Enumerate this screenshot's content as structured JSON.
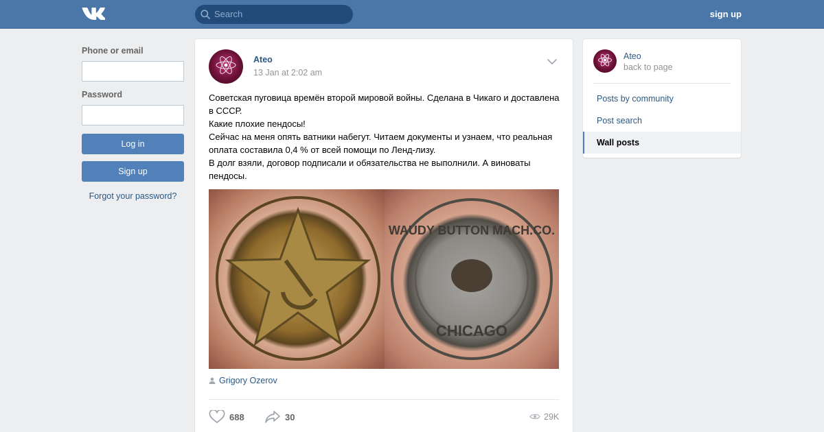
{
  "header": {
    "logo_icon": "vk-logo-icon",
    "search_placeholder": "Search",
    "signup_label": "sign up"
  },
  "login": {
    "email_label": "Phone or email",
    "email_value": "",
    "password_label": "Password",
    "password_value": "",
    "login_button": "Log in",
    "signup_button": "Sign up",
    "forgot_link": "Forgot your password?"
  },
  "post": {
    "author": "Ateo",
    "date": "13 Jan at 2:02 am",
    "text_lines": [
      "Советская пуговица времён второй мировой войны. Сделана в Чикаго и доставлена в СССР.",
      "Какие плохие пендосы!",
      "Сейчас на меня опять ватники набегут. Читаем документы и узнаем, что реальная оплата составила 0,4 % от всей помощи по Ленд-лизу.",
      "В долг взяли, договор подписали и обязательства не выполнили. А виноваты пендосы."
    ],
    "photo1_icon": "soviet-button-front-photo",
    "photo2_icon": "chicago-button-back-photo",
    "photo2_text": {
      "maker": "WAUDY BUTTON MACH.CO.",
      "city": "CHICAGO"
    },
    "signer": "Grigory Ozerov",
    "likes": "688",
    "shares": "30",
    "views": "29K"
  },
  "sidebar": {
    "name": "Ateo",
    "back": "back to page",
    "items": [
      {
        "label": "Posts by community",
        "active": false
      },
      {
        "label": "Post search",
        "active": false
      },
      {
        "label": "Wall posts",
        "active": true
      }
    ]
  },
  "colors": {
    "header_bg": "#4a76a8",
    "link": "#2a5885",
    "button": "#5181b8",
    "page_bg": "#edeef0"
  }
}
